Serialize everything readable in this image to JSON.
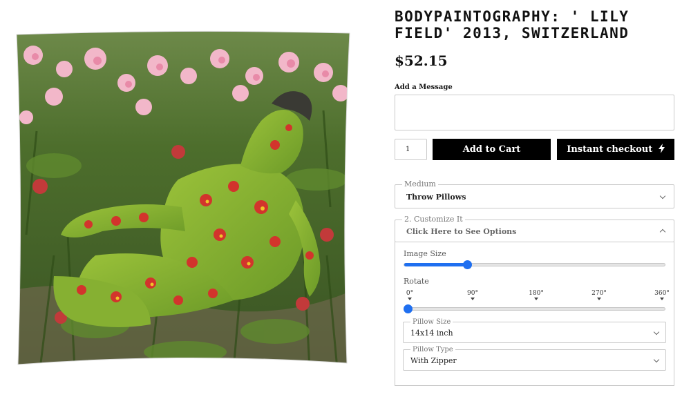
{
  "product": {
    "title": "BODYPAINTOGRAPHY: ' LILY FIELD' 2013, SWITZERLAND",
    "price": "$52.15"
  },
  "message": {
    "label": "Add a Message",
    "value": ""
  },
  "quantity": "1",
  "buttons": {
    "add_to_cart": "Add to Cart",
    "instant_checkout": "Instant checkout"
  },
  "medium": {
    "legend": "Medium",
    "value": "Throw Pillows"
  },
  "customize": {
    "legend": "2. Customize It",
    "value": "Click Here to See Options",
    "image_size": {
      "label": "Image Size",
      "level": 0.24
    },
    "rotate": {
      "label": "Rotate",
      "ticks": [
        "0°",
        "90°",
        "180°",
        "270°",
        "360°"
      ],
      "value_degrees": 0
    },
    "pillow_size": {
      "legend": "Pillow Size",
      "value": "14x14 inch"
    },
    "pillow_type": {
      "legend": "Pillow Type",
      "value": "With Zipper"
    }
  },
  "colors": {
    "accent": "#1f6ff0",
    "button": "#000000",
    "border": "#c9c9c9"
  }
}
